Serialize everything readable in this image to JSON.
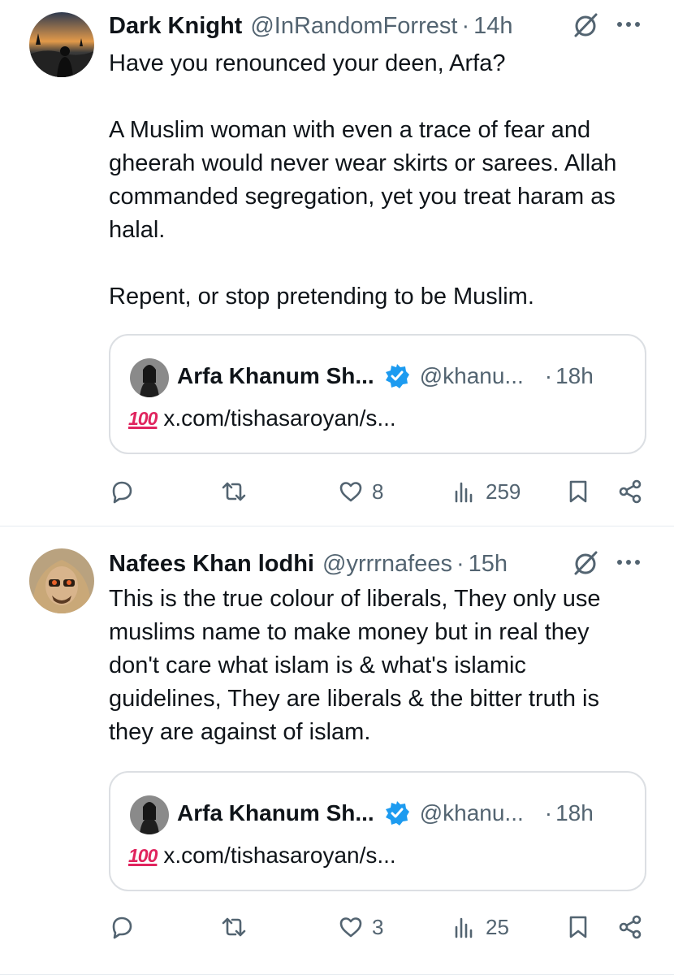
{
  "tweets": [
    {
      "author_name": "Dark Knight",
      "handle": "@InRandomForrest",
      "separator": "·",
      "time": "14h",
      "text": "Have you renounced your deen, Arfa?\n\nA Muslim woman with even a trace of fear and gheerah would never wear skirts or sarees. Allah commanded segregation, yet you treat haram as halal.\n\nRepent, or stop pretending to be Muslim.",
      "quote": {
        "author_name": "Arfa Khanum Sh...",
        "handle": "@khanu...",
        "separator": "·",
        "time": "18h",
        "emoji": "100",
        "link_text": "x.com/tishasaroyan/s..."
      },
      "stats": {
        "replies": "",
        "reposts": "",
        "likes": "8",
        "views": "259"
      }
    },
    {
      "author_name": "Nafees Khan lodhi",
      "handle": "@yrrrnafees",
      "separator": "·",
      "time": "15h",
      "text": "This is the true colour of liberals, They only use muslims name to make money but in real they don't care what islam is & what's islamic guidelines, They are liberals & the bitter truth is they are against of islam.",
      "quote": {
        "author_name": "Arfa Khanum Sh...",
        "handle": "@khanu...",
        "separator": "·",
        "time": "18h",
        "emoji": "100",
        "link_text": "x.com/tishasaroyan/s..."
      },
      "stats": {
        "replies": "",
        "reposts": "",
        "likes": "3",
        "views": "25"
      }
    }
  ],
  "icons": {
    "reply": "reply-icon",
    "repost": "repost-icon",
    "like": "heart-icon",
    "views": "views-icon",
    "bookmark": "bookmark-icon",
    "share": "share-icon",
    "grok": "grok-icon",
    "more": "more-icon",
    "verified": "verified-badge-icon"
  },
  "colors": {
    "text": "#0f1419",
    "secondary": "#536471",
    "verified": "#1d9bf0",
    "border": "#dcdfe3"
  }
}
